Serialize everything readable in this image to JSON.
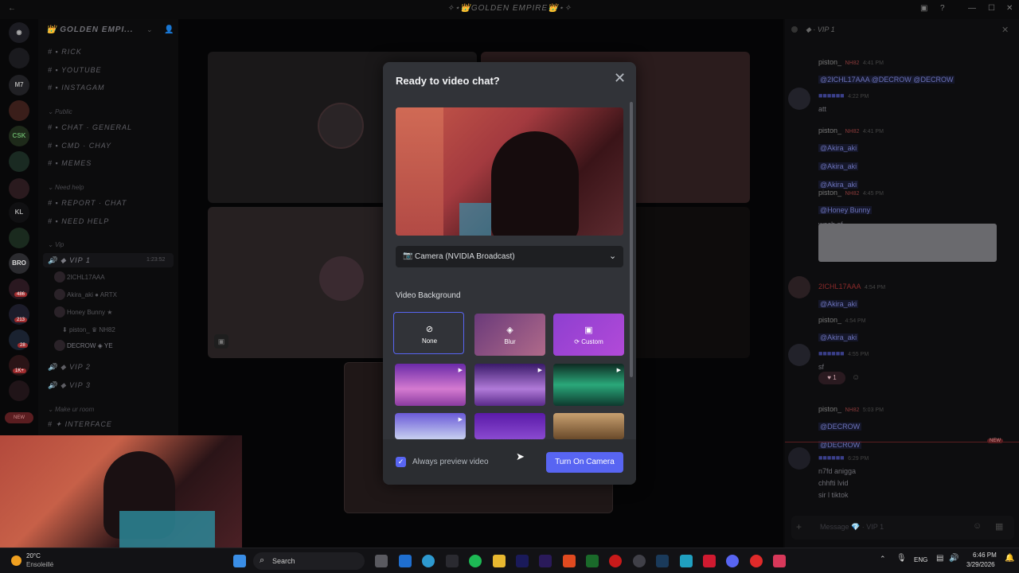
{
  "titlebar": {
    "title": "✧⋆👑GOLDEN EMPIRE👑⋆✧"
  },
  "server": {
    "name": "👑 GOLDEN EMPI..."
  },
  "rail": [
    "M7",
    "CSK",
    "KL",
    "BRO",
    "NEW"
  ],
  "rail_badges": [
    "486",
    "213",
    "28",
    "1K+"
  ],
  "channels": {
    "top": [
      "RICK",
      "YOUTUBE",
      "INSTAGAM"
    ],
    "public_cat": "Public",
    "public": [
      "CHAT · GENERAL",
      "CMD · CHAY",
      "MEMES"
    ],
    "help_cat": "Need help",
    "help": [
      "REPORT · CHAT",
      "NEED HELP"
    ],
    "vip_cat": "Vip",
    "vip_selected": "VIP 1",
    "vip_timer": "1:23:52",
    "members": [
      "2ICHL17AAA",
      "Akira_aki",
      "Honey Bunny",
      "piston_",
      "DECROW"
    ],
    "member_tags": [
      "ARTX",
      "NH82",
      "YE"
    ],
    "vip_more": [
      "VIP 2",
      "VIP 3"
    ],
    "room_cat": "Make ur room",
    "room": [
      "INTERFACE"
    ]
  },
  "chat": {
    "header": "VIP 1",
    "messages": [
      {
        "author": "piston_",
        "tag": "NH82",
        "time": "4:41 PM",
        "lines": [
          "@2ICHL17AAA @DECROW @DECROW"
        ]
      },
      {
        "author": "",
        "tag": "",
        "time": "4:22 PM",
        "lines": [
          "att"
        ]
      },
      {
        "author": "piston_",
        "tag": "NH82",
        "time": "4:41 PM",
        "lines": [
          "@Akira_aki",
          "@Akira_aki",
          "@Akira_aki"
        ]
      },
      {
        "author": "piston_",
        "tag": "NH82",
        "time": "4:45 PM",
        "lines": [
          "@Honey Bunny",
          "wach sf"
        ]
      },
      {
        "author": "2ICHL17AAA",
        "tag": "",
        "time": "4:54 PM",
        "lines": [
          "@Akira_aki"
        ]
      },
      {
        "author": "piston_",
        "tag": "",
        "time": "4:54 PM",
        "lines": [
          "@Akira_aki"
        ]
      },
      {
        "author": "",
        "tag": "",
        "time": "4:55 PM",
        "lines": [
          "sf"
        ]
      },
      {
        "author": "piston_",
        "tag": "NH82",
        "time": "5:03 PM",
        "lines": [
          "@DECROW",
          "@DECROW"
        ]
      },
      {
        "author": "",
        "tag": "",
        "time": "6:29 PM",
        "lines": [
          "n7fd aniggа",
          "chhfti lvid",
          "sir l tiktok"
        ]
      }
    ],
    "reaction_count": "1",
    "new_label": "NEW",
    "input_placeholder": "Message 💎 · VIP 1"
  },
  "modal": {
    "title": "Ready to video chat?",
    "camera_label": "Camera (NVIDIA Broadcast)",
    "video_bg_label": "Video Background",
    "options": [
      {
        "label": "None"
      },
      {
        "label": "Blur"
      },
      {
        "label": "Custom"
      }
    ],
    "always_preview_label": "Always preview video",
    "always_preview_checked": true,
    "turn_on_label": "Turn On Camera"
  },
  "taskbar": {
    "weather_temp": "20°C",
    "weather_desc": "Ensoleillé",
    "search_placeholder": "Search",
    "lang": "ENG",
    "time": "6:46 PM",
    "date": "3/29/2026"
  },
  "colors": {
    "accent": "#5865f2",
    "modal_bg": "#313338",
    "footer_bg": "#2b2d31"
  }
}
